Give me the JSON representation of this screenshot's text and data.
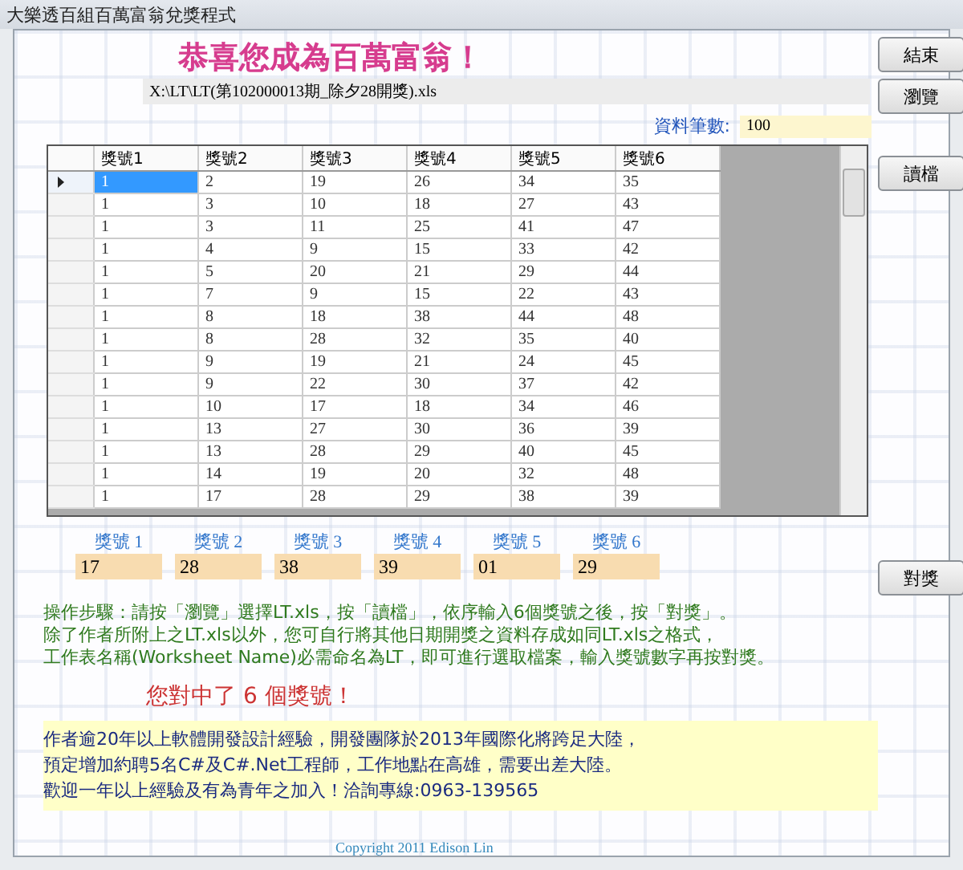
{
  "window": {
    "title": "大樂透百組百萬富翁兌獎程式"
  },
  "headline": "恭喜您成為百萬富翁！",
  "file_path": "X:\\LT\\LT(第102000013期_除夕28開獎).xls",
  "record_count": {
    "label": "資料筆數:",
    "value": "100"
  },
  "buttons": {
    "exit": "結束",
    "browse": "瀏覽",
    "load": "讀檔",
    "check": "對獎"
  },
  "table": {
    "columns": [
      "獎號1",
      "獎號2",
      "獎號3",
      "獎號4",
      "獎號5",
      "獎號6"
    ],
    "rows": [
      {
        "selected": true,
        "cells": [
          "1",
          "2",
          "19",
          "26",
          "34",
          "35"
        ]
      },
      {
        "selected": false,
        "cells": [
          "1",
          "3",
          "10",
          "18",
          "27",
          "43"
        ]
      },
      {
        "selected": false,
        "cells": [
          "1",
          "3",
          "11",
          "25",
          "41",
          "47"
        ]
      },
      {
        "selected": false,
        "cells": [
          "1",
          "4",
          "9",
          "15",
          "33",
          "42"
        ]
      },
      {
        "selected": false,
        "cells": [
          "1",
          "5",
          "20",
          "21",
          "29",
          "44"
        ]
      },
      {
        "selected": false,
        "cells": [
          "1",
          "7",
          "9",
          "15",
          "22",
          "43"
        ]
      },
      {
        "selected": false,
        "cells": [
          "1",
          "8",
          "18",
          "38",
          "44",
          "48"
        ]
      },
      {
        "selected": false,
        "cells": [
          "1",
          "8",
          "28",
          "32",
          "35",
          "40"
        ]
      },
      {
        "selected": false,
        "cells": [
          "1",
          "9",
          "19",
          "21",
          "24",
          "45"
        ]
      },
      {
        "selected": false,
        "cells": [
          "1",
          "9",
          "22",
          "30",
          "37",
          "42"
        ]
      },
      {
        "selected": false,
        "cells": [
          "1",
          "10",
          "17",
          "18",
          "34",
          "46"
        ]
      },
      {
        "selected": false,
        "cells": [
          "1",
          "13",
          "27",
          "30",
          "36",
          "39"
        ]
      },
      {
        "selected": false,
        "cells": [
          "1",
          "13",
          "28",
          "29",
          "40",
          "45"
        ]
      },
      {
        "selected": false,
        "cells": [
          "1",
          "14",
          "19",
          "20",
          "32",
          "48"
        ]
      },
      {
        "selected": false,
        "cells": [
          "1",
          "17",
          "28",
          "29",
          "38",
          "39"
        ]
      }
    ]
  },
  "numbers": [
    {
      "label": "獎號 1",
      "value": "17"
    },
    {
      "label": "獎號 2",
      "value": "28"
    },
    {
      "label": "獎號 3",
      "value": "38"
    },
    {
      "label": "獎號 4",
      "value": "39"
    },
    {
      "label": "獎號 5",
      "value": "01"
    },
    {
      "label": "獎號 6",
      "value": "29"
    }
  ],
  "instructions": [
    "操作步驟：請按「瀏覽」選擇LT.xls，按「讀檔」，依序輸入6個獎號之後，按「對獎」。",
    "除了作者所附上之LT.xls以外，您可自行將其他日期開獎之資料存成如同LT.xls之格式，",
    "工作表名稱(Worksheet Name)必需命名為LT，即可進行選取檔案，輸入獎號數字再按對獎。"
  ],
  "result": "您對中了 6 個獎號！",
  "notice": [
    "作者逾20年以上軟體開發設計經驗，開發團隊於2013年國際化將跨足大陸，",
    "預定增加約聘5名C#及C#.Net工程師，工作地點在高雄，需要出差大陸。",
    "歡迎一年以上經驗及有為青年之加入！洽詢專線:0963-139565"
  ],
  "copyright": "Copyright 2011 Edison Lin"
}
